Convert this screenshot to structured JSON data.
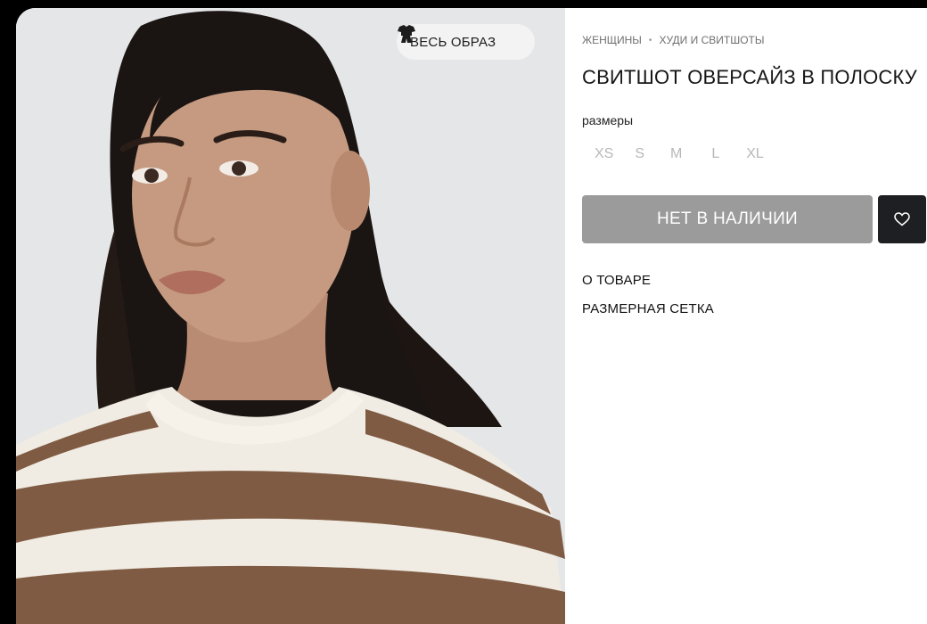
{
  "photo": {
    "look_button_label": "ВЕСЬ ОБРАЗ",
    "look_icon": "outfit-icon",
    "stripe_colors": {
      "brown": "#7f5b43",
      "cream": "#f1ece3"
    }
  },
  "breadcrumb": {
    "items": [
      "ЖЕНЩИНЫ",
      "ХУДИ И СВИТШОТЫ"
    ],
    "separator": "•"
  },
  "product": {
    "title": "СВИТШОТ ОВЕРСАЙЗ В ПОЛОСКУ",
    "sizes_label": "размеры",
    "sizes": [
      "XS",
      "S",
      "M",
      "L",
      "XL"
    ],
    "availability_button": "НЕТ В НАЛИЧИИ",
    "favorite_icon": "heart-icon"
  },
  "info_links": [
    "О ТОВАРЕ",
    "РАЗМЕРНАЯ СЕТКА"
  ],
  "colors": {
    "button_disabled": "#9b9b9b",
    "favorite_bg": "#1e1f22",
    "size_text": "#b8b8b8"
  }
}
